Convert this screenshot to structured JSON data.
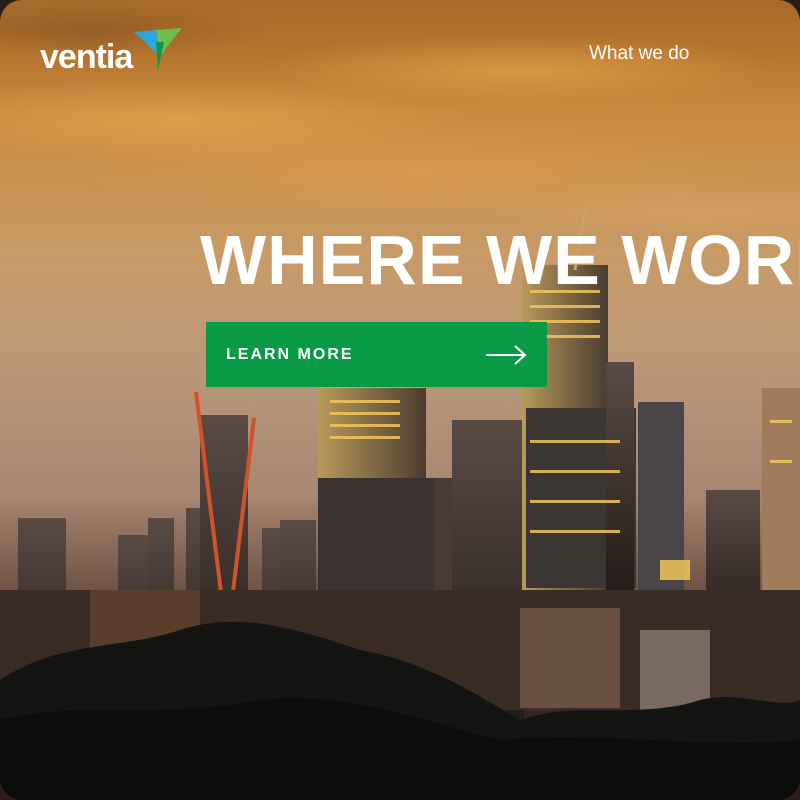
{
  "header": {
    "logo_text": "ventia",
    "nav": [
      {
        "label": "What we do"
      }
    ]
  },
  "hero": {
    "title": "WHERE WE WORK",
    "cta_label": "LEARN MORE",
    "cta_icon": "arrow-right-icon"
  },
  "colors": {
    "brand_green": "#0a9a45",
    "logo_blue": "#2aa7df",
    "logo_green": "#6cc04a"
  }
}
